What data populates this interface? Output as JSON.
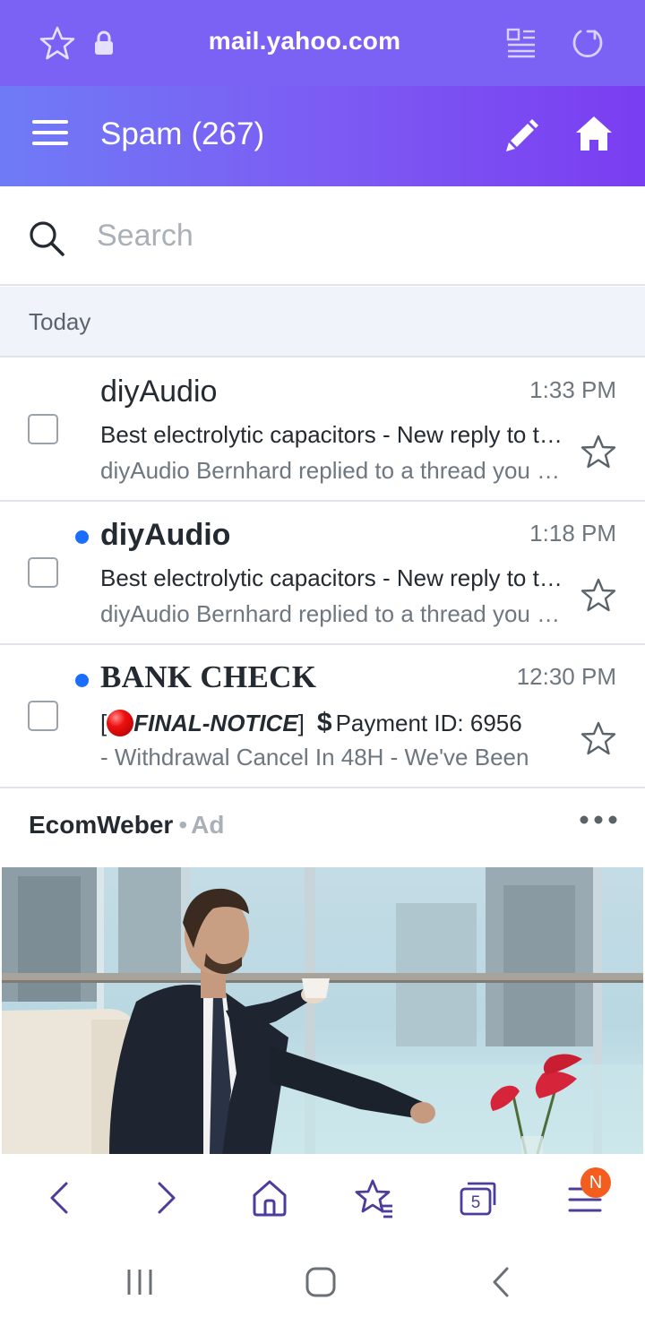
{
  "browser": {
    "url": "mail.yahoo.com",
    "accent_color": "#7b62f5",
    "icons": [
      "star-outline-icon",
      "lock-icon",
      "reader-mode-icon",
      "reload-icon"
    ]
  },
  "header": {
    "folder_name": "Spam",
    "folder_count": "(267)",
    "icons": [
      "hamburger-menu-icon",
      "compose-pencil-icon",
      "home-icon"
    ]
  },
  "search": {
    "placeholder": "Search",
    "value": ""
  },
  "section_label": "Today",
  "messages": [
    {
      "sender": "diyAudio",
      "time": "1:33 PM",
      "subject": "Best electrolytic capacitors - New reply to thread",
      "preview": "diyAudio Bernhard replied to a thread you are watching",
      "unread": false,
      "starred": false
    },
    {
      "sender": "diyAudio",
      "time": "1:18 PM",
      "subject": "Best electrolytic capacitors - New reply to thread",
      "preview": "diyAudio Bernhard replied to a thread you are watching",
      "unread": true,
      "starred": false
    },
    {
      "sender": "BANK CHECK",
      "time": "12:30 PM",
      "subject_prefix": "[",
      "subject_emphasis": "FINAL-NOTICE",
      "subject_suffix": "]",
      "subject_dollar": "$",
      "subject_rest": "Payment ID: 6956",
      "preview": "- Withdrawal Cancel In 48H - We've Been",
      "unread": true,
      "starred": false
    }
  ],
  "ad": {
    "brand": "EcomWeber",
    "separator": "•",
    "label": "Ad"
  },
  "bottom_nav": {
    "tab_count": "5",
    "badge": "N",
    "badge_color": "#f35e1f",
    "icons": [
      "back-icon",
      "forward-icon",
      "home-icon",
      "bookmarks-icon",
      "tabs-icon",
      "menu-icon"
    ]
  },
  "system_nav": {
    "icons": [
      "recents-icon",
      "home-button-icon",
      "back-icon"
    ]
  }
}
